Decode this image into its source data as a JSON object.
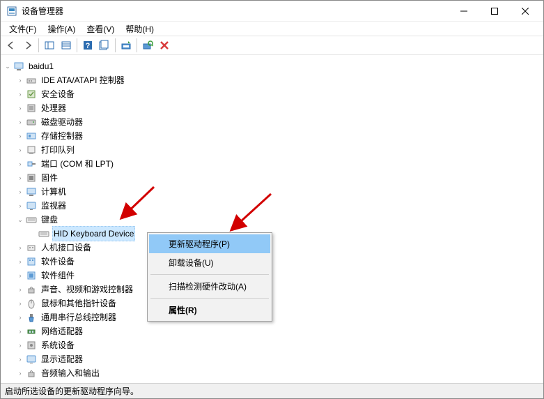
{
  "window": {
    "title": "设备管理器"
  },
  "menubar": {
    "file": "文件(F)",
    "action": "操作(A)",
    "view": "查看(V)",
    "help": "帮助(H)"
  },
  "tree": {
    "root": "baidu1",
    "items": [
      "IDE ATA/ATAPI 控制器",
      "安全设备",
      "处理器",
      "磁盘驱动器",
      "存储控制器",
      "打印队列",
      "端口 (COM 和 LPT)",
      "固件",
      "计算机",
      "监视器"
    ],
    "keyboard": "键盘",
    "keyboard_child": "HID Keyboard Device",
    "items2": [
      "人机接口设备",
      "软件设备",
      "软件组件",
      "声音、视频和游戏控制器",
      "鼠标和其他指针设备",
      "通用串行总线控制器",
      "网络适配器",
      "系统设备",
      "显示适配器",
      "音频输入和输出"
    ]
  },
  "contextmenu": {
    "update": "更新驱动程序(P)",
    "uninstall": "卸载设备(U)",
    "scan": "扫描检测硬件改动(A)",
    "properties": "属性(R)"
  },
  "statusbar": {
    "text": "启动所选设备的更新驱动程序向导。"
  }
}
